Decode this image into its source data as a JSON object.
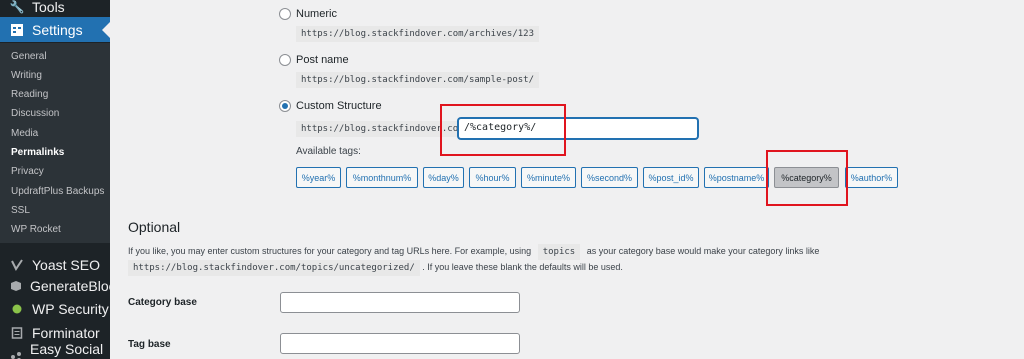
{
  "sidebar": {
    "tools_label": "Tools",
    "settings_label": "Settings",
    "submenu": [
      "General",
      "Writing",
      "Reading",
      "Discussion",
      "Media",
      "Permalinks",
      "Privacy",
      "UpdraftPlus Backups",
      "SSL",
      "WP Rocket"
    ],
    "plugins": [
      "Yoast SEO",
      "GenerateBlocks",
      "WP Security",
      "Forminator",
      "Easy Social Share"
    ]
  },
  "permalinks": {
    "numeric_label": "Numeric",
    "numeric_example": "https://blog.stackfindover.com/archives/123",
    "postname_label": "Post name",
    "postname_example": "https://blog.stackfindover.com/sample-post/",
    "custom_label": "Custom Structure",
    "custom_prefix": "https://blog.stackfindover.com",
    "custom_value": "/%category%/",
    "available_tags_label": "Available tags:",
    "tags": [
      "%year%",
      "%monthnum%",
      "%day%",
      "%hour%",
      "%minute%",
      "%second%",
      "%post_id%",
      "%postname%",
      "%category%",
      "%author%"
    ],
    "active_tag": "%category%"
  },
  "optional": {
    "heading": "Optional",
    "desc_part1": "If you like, you may enter custom structures for your category and tag URLs here. For example, using",
    "desc_code1": "topics",
    "desc_part2": "as your category base would make your category links like",
    "desc_code2": "https://blog.stackfindover.com/topics/uncategorized/",
    "desc_part3": ". If you leave these blank the defaults will be used.",
    "category_base_label": "Category base",
    "category_base_value": "",
    "tag_base_label": "Tag base",
    "tag_base_value": ""
  },
  "colors": {
    "sidebar_bg": "#1d2327",
    "active_menu": "#2271b1",
    "highlight": "#e0141e"
  }
}
